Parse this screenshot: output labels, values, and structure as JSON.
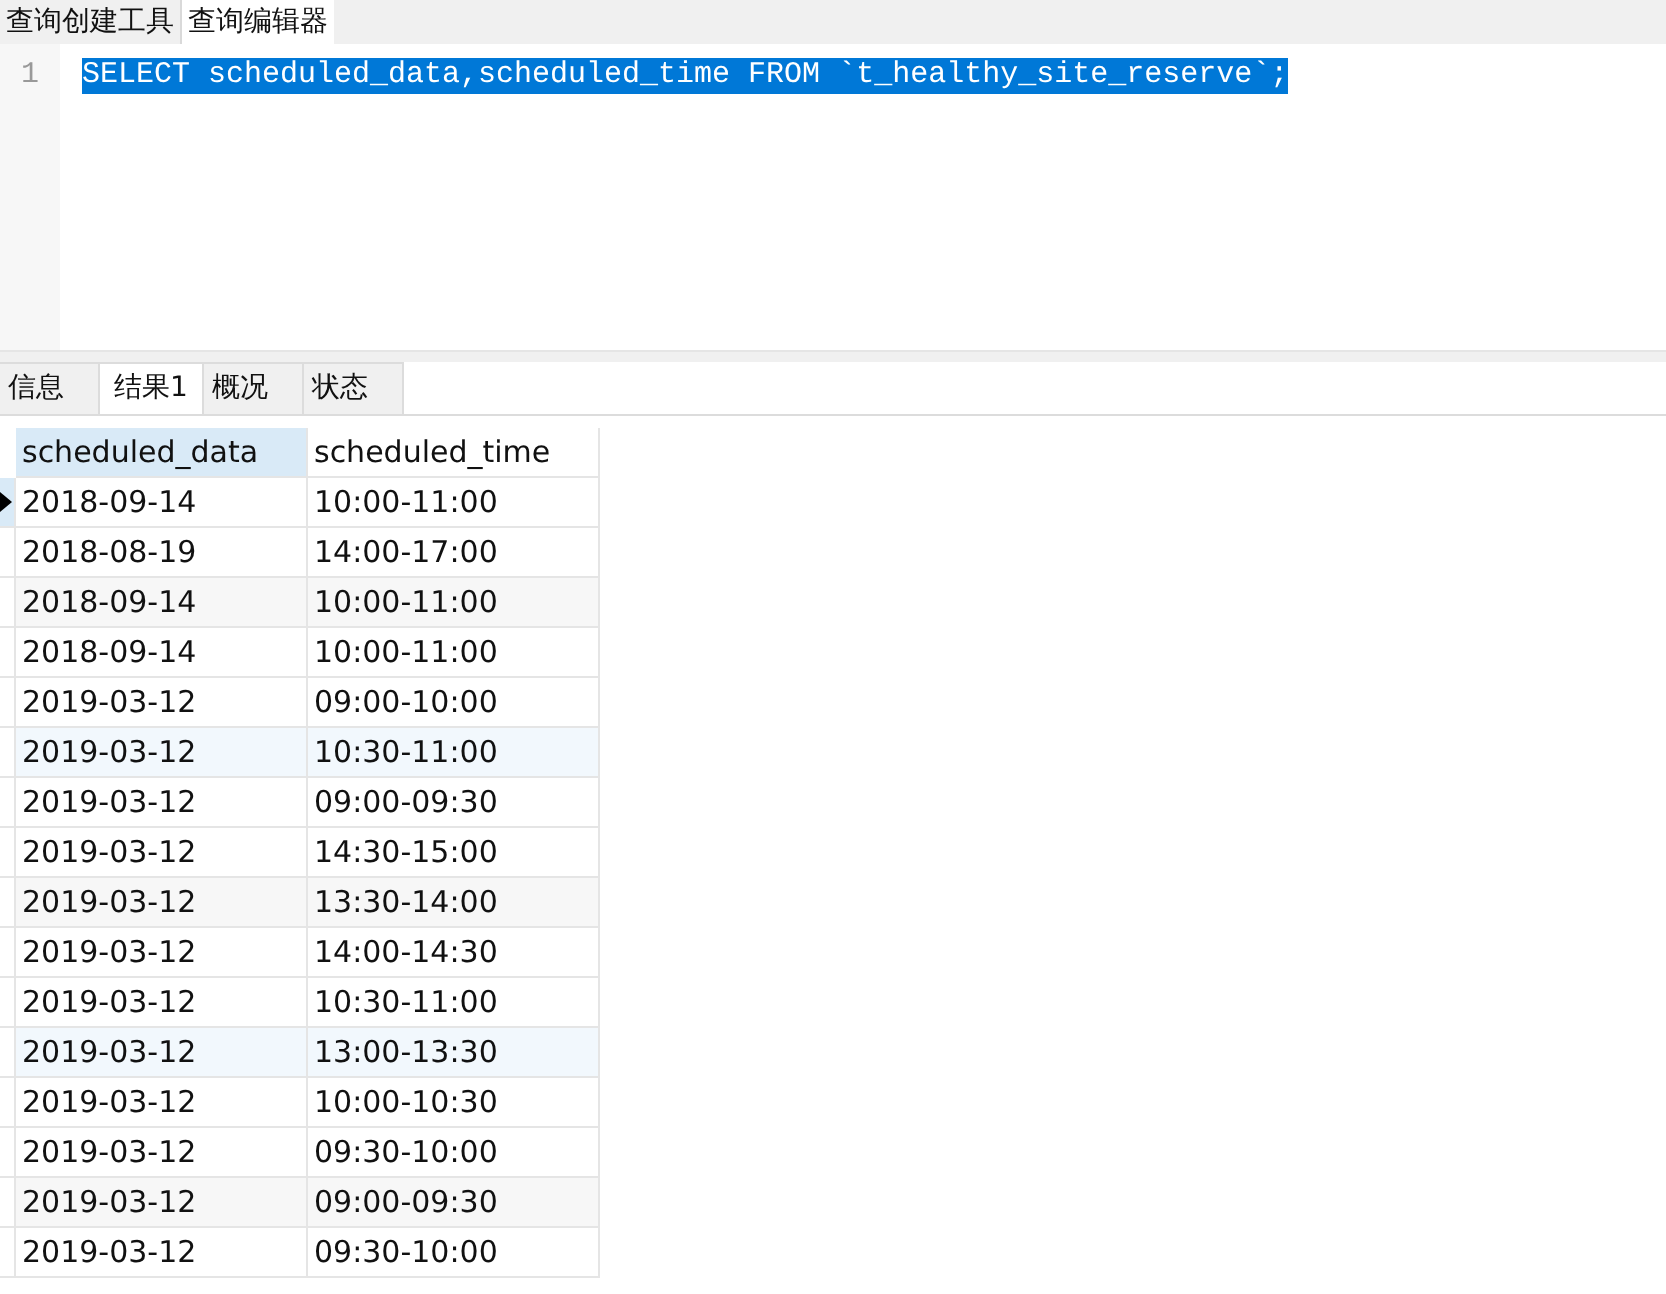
{
  "tabs": [
    {
      "label": "查询创建工具",
      "selected": false
    },
    {
      "label": "查询编辑器",
      "selected": true
    }
  ],
  "editor": {
    "lines": [
      {
        "number": "1",
        "text": "SELECT scheduled_data,scheduled_time FROM `t_healthy_site_reserve`;",
        "selected": true
      }
    ]
  },
  "result_tabs": [
    {
      "label": "信息",
      "selected": false
    },
    {
      "label": "结果1",
      "selected": true
    },
    {
      "label": "概况",
      "selected": false
    },
    {
      "label": "状态",
      "selected": false
    }
  ],
  "table": {
    "columns": [
      {
        "label": "scheduled_data",
        "selected": true
      },
      {
        "label": "scheduled_time",
        "selected": false
      }
    ],
    "rows": [
      {
        "cells": [
          "2018-09-14",
          "10:00-11:00"
        ],
        "current": true,
        "color": "#ffffff"
      },
      {
        "cells": [
          "2018-08-19",
          "14:00-17:00"
        ],
        "current": false,
        "color": "#ffffff"
      },
      {
        "cells": [
          "2018-09-14",
          "10:00-11:00"
        ],
        "current": false,
        "color": "#f7f7f7"
      },
      {
        "cells": [
          "2018-09-14",
          "10:00-11:00"
        ],
        "current": false,
        "color": "#ffffff"
      },
      {
        "cells": [
          "2019-03-12",
          "09:00-10:00"
        ],
        "current": false,
        "color": "#ffffff"
      },
      {
        "cells": [
          "2019-03-12",
          "10:30-11:00"
        ],
        "current": false,
        "color": "#f2f8fd"
      },
      {
        "cells": [
          "2019-03-12",
          "09:00-09:30"
        ],
        "current": false,
        "color": "#ffffff"
      },
      {
        "cells": [
          "2019-03-12",
          "14:30-15:00"
        ],
        "current": false,
        "color": "#ffffff"
      },
      {
        "cells": [
          "2019-03-12",
          "13:30-14:00"
        ],
        "current": false,
        "color": "#f7f7f7"
      },
      {
        "cells": [
          "2019-03-12",
          "14:00-14:30"
        ],
        "current": false,
        "color": "#ffffff"
      },
      {
        "cells": [
          "2019-03-12",
          "10:30-11:00"
        ],
        "current": false,
        "color": "#ffffff"
      },
      {
        "cells": [
          "2019-03-12",
          "13:00-13:30"
        ],
        "current": false,
        "color": "#f2f8fd"
      },
      {
        "cells": [
          "2019-03-12",
          "10:00-10:30"
        ],
        "current": false,
        "color": "#ffffff"
      },
      {
        "cells": [
          "2019-03-12",
          "09:30-10:00"
        ],
        "current": false,
        "color": "#ffffff"
      },
      {
        "cells": [
          "2019-03-12",
          "09:00-09:30"
        ],
        "current": false,
        "color": "#f7f7f7"
      },
      {
        "cells": [
          "2019-03-12",
          "09:30-10:00"
        ],
        "current": false,
        "color": "#ffffff"
      }
    ]
  }
}
